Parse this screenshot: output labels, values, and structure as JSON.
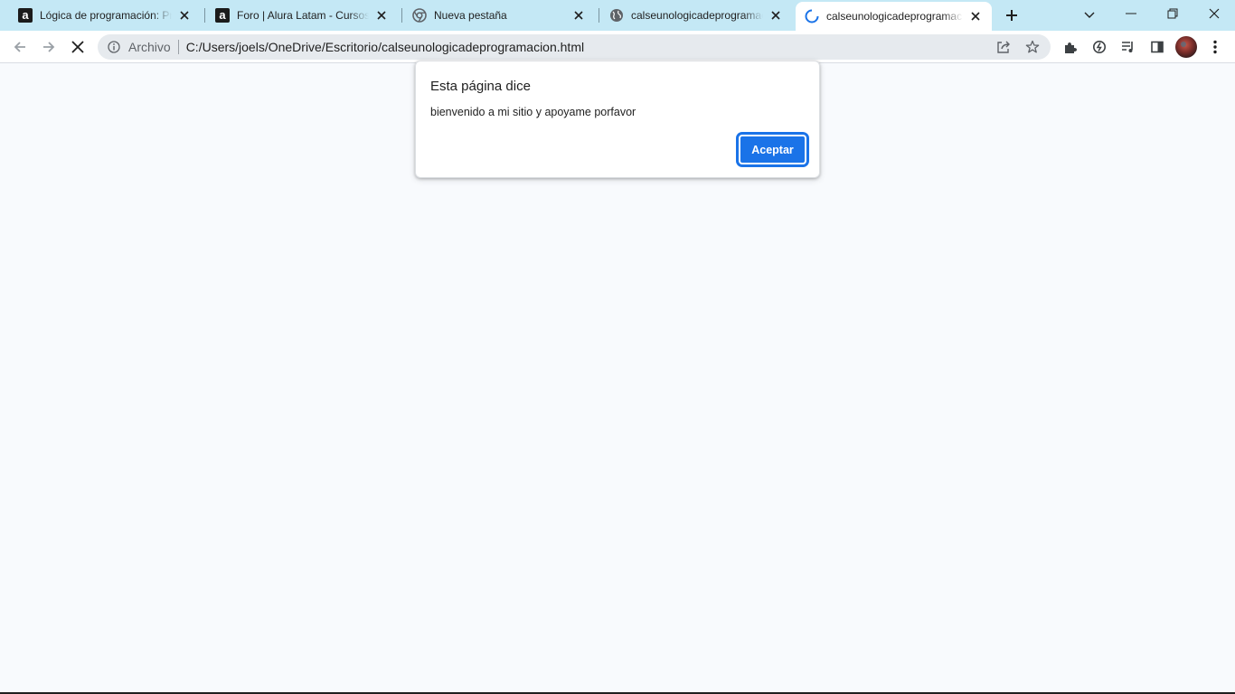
{
  "browser": {
    "tabs": [
      {
        "title": "Lógica de programación: Primeros pasos",
        "favicon": "alura-icon",
        "active": false
      },
      {
        "title": "Foro | Alura Latam - Cursos online",
        "favicon": "alura-icon",
        "active": false
      },
      {
        "title": "Nueva pestaña",
        "favicon": "chrome-icon",
        "active": false
      },
      {
        "title": "calseunologicadeprogramacion.html",
        "favicon": "globe-icon",
        "active": false
      },
      {
        "title": "calseunologicadeprogramacion.html",
        "favicon": "loading-spinner-icon",
        "active": true
      }
    ],
    "omnibox": {
      "scheme_label": "Archivo",
      "url": "C:/Users/joels/OneDrive/Escritorio/calseunologicadeprogramacion.html"
    },
    "colors": {
      "tabstrip": "#c4e8f5",
      "accent": "#1a73e8",
      "page_bg": "#f8fafd"
    }
  },
  "dialog": {
    "title": "Esta página dice",
    "message": "bienvenido a mi sitio y apoyame porfavor",
    "ok_label": "Aceptar"
  }
}
